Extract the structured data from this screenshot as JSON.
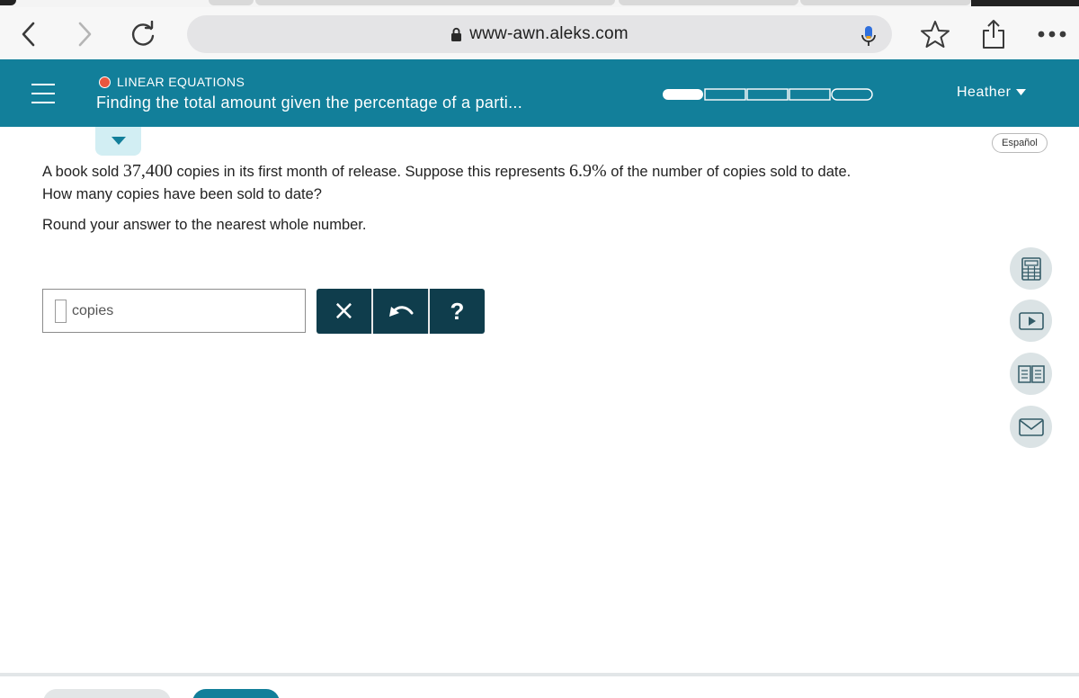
{
  "browser": {
    "url": "www-awn.aleks.com"
  },
  "header": {
    "topic": "LINEAR EQUATIONS",
    "title": "Finding the total amount given the percentage of a parti...",
    "user": "Heather",
    "progress": {
      "segments": 5,
      "filled": 1
    }
  },
  "language_label": "Español",
  "problem": {
    "part1": "A book sold ",
    "copies": "37,400",
    "part2": " copies in its first month of release. Suppose this represents ",
    "percent": "6.9%",
    "part3": " of the number of copies sold to date.",
    "question": "How many copies have been sold to date?",
    "instruction": "Round your answer to the nearest whole number."
  },
  "answer": {
    "value": "",
    "unit": "copies"
  },
  "actions": {
    "clear": "×",
    "help": "?"
  },
  "colors": {
    "header_bg": "#127f9a",
    "action_bg": "#0f3d4c",
    "topic_dot": "#e9573f"
  },
  "icons": {
    "back": "chevron-left-icon",
    "forward": "chevron-right-icon",
    "reload": "reload-icon",
    "lock": "lock-icon",
    "mic": "microphone-icon",
    "bookmark": "star-icon",
    "share": "share-icon",
    "more": "more-icon",
    "calculator": "calculator-icon",
    "video": "video-icon",
    "book": "book-icon",
    "mail": "mail-icon"
  }
}
